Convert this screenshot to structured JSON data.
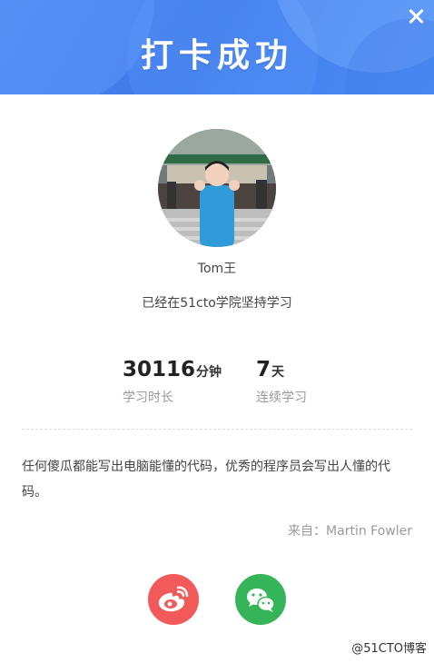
{
  "header": {
    "title": "打卡成功",
    "close_icon": "close-icon",
    "bg_color": "#4a86f0"
  },
  "profile": {
    "avatar_icon": "avatar-photo",
    "name": "Tom王",
    "subtitle": "已经在51cto学院坚持学习"
  },
  "stats": [
    {
      "value": "30116",
      "unit": "分钟",
      "label": "学习时长"
    },
    {
      "value": "7",
      "unit": "天",
      "label": "连续学习"
    }
  ],
  "quote": {
    "text": "任何傻瓜都能写出电脑能懂的代码，优秀的程序员会写出人懂的代码。",
    "source": "来自：Martin Fowler"
  },
  "share": {
    "weibo": {
      "icon": "weibo-icon",
      "color": "#f25a5a"
    },
    "wechat": {
      "icon": "wechat-icon",
      "color": "#36b45a"
    }
  },
  "watermark": "@51CTO博客"
}
